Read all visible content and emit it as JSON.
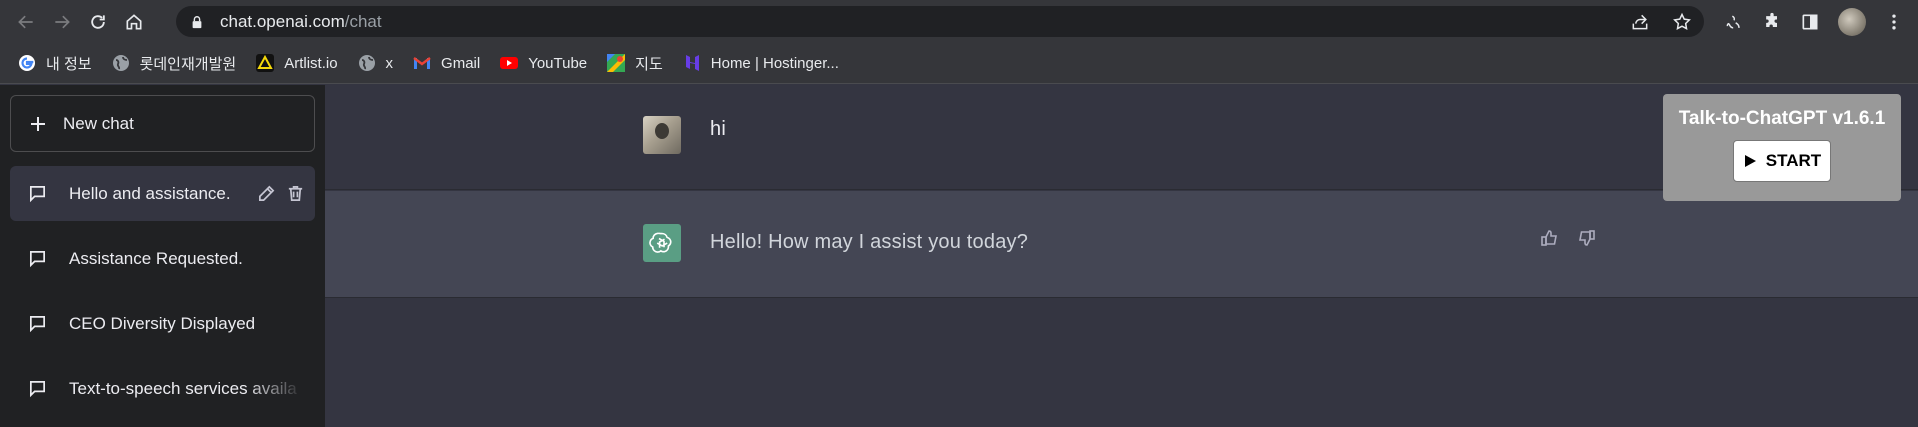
{
  "browser": {
    "url_host": "chat.openai.com",
    "url_path": "/chat"
  },
  "bookmarks": [
    {
      "label": "내 정보",
      "icon": "google-icon"
    },
    {
      "label": "롯데인재개발원",
      "icon": "globe-icon"
    },
    {
      "label": "Artlist.io",
      "icon": "artlist-icon"
    },
    {
      "label": "x",
      "icon": "globe-icon"
    },
    {
      "label": "Gmail",
      "icon": "gmail-icon"
    },
    {
      "label": "YouTube",
      "icon": "youtube-icon"
    },
    {
      "label": "지도",
      "icon": "maps-icon"
    },
    {
      "label": "Home | Hostinger...",
      "icon": "hostinger-icon"
    }
  ],
  "sidebar": {
    "new_chat_label": "New chat",
    "conversations": [
      {
        "title": "Hello and assistance."
      },
      {
        "title": "Assistance Requested."
      },
      {
        "title": "CEO Diversity Displayed"
      },
      {
        "title": "Text-to-speech services availa"
      }
    ]
  },
  "chat": {
    "user_message": "hi",
    "assistant_message": "Hello! How may I assist you today?"
  },
  "extension": {
    "title": "Talk-to-ChatGPT v1.6.1",
    "start_label": "START"
  },
  "colors": {
    "sidebar_bg": "#202123",
    "main_bg": "#343541",
    "assistant_row_bg": "#444654",
    "assistant_avatar": "#5a9e84",
    "extension_panel": "#999999"
  }
}
